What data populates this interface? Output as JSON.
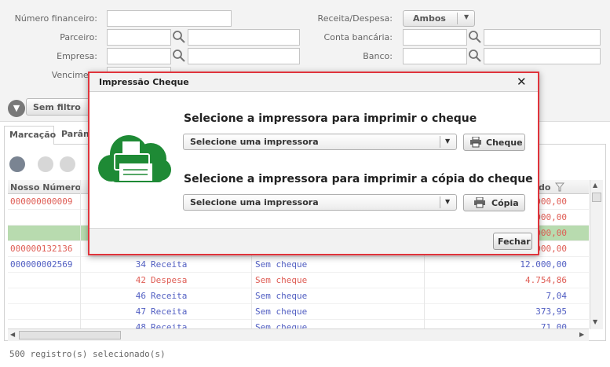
{
  "filters": {
    "numero_financeiro_label": "Número financeiro:",
    "parceiro_label": "Parceiro:",
    "empresa_label": "Empresa:",
    "vencimento_label": "Venciment",
    "receita_despesa_label": "Receita/Despesa:",
    "receita_despesa_value": "Ambos",
    "conta_bancaria_label": "Conta bancária:",
    "banco_label": "Banco:",
    "sem_filtro_label": "Sem filtro"
  },
  "tabs": [
    {
      "label": "Marcação"
    },
    {
      "label": "Parâm"
    }
  ],
  "grid": {
    "col_nosso_numero": "Nosso Número",
    "col_valor_partial": "do",
    "rows": [
      {
        "nosso_numero": "000000000009",
        "num": "",
        "tipo": "",
        "cheque": "",
        "valor": "000,00",
        "nn_color": "#d8392f",
        "tipo_color": "#2b3bb5",
        "valor_color": "#d8392f",
        "highlight": false
      },
      {
        "nosso_numero": "",
        "num": "",
        "tipo": "",
        "cheque": "",
        "valor": "000,00",
        "nn_color": "#d8392f",
        "tipo_color": "#2b3bb5",
        "valor_color": "#d8392f",
        "highlight": false
      },
      {
        "nosso_numero": "",
        "num": "",
        "tipo": "",
        "cheque": "",
        "valor": "000,00",
        "nn_color": "#d8392f",
        "tipo_color": "#2b3bb5",
        "valor_color": "#d8392f",
        "highlight": true
      },
      {
        "nosso_numero": "000000132136",
        "num": "",
        "tipo": "",
        "cheque": "",
        "valor": "000,00",
        "nn_color": "#d8392f",
        "tipo_color": "#2b3bb5",
        "valor_color": "#d8392f",
        "highlight": false
      },
      {
        "nosso_numero": "000000002569",
        "num": "34",
        "tipo": "Receita",
        "cheque": "Sem cheque",
        "valor": "12.000,00",
        "nn_color": "#2b3bb5",
        "tipo_color": "#2b3bb5",
        "valor_color": "#2b3bb5",
        "highlight": false
      },
      {
        "nosso_numero": "",
        "num": "42",
        "tipo": "Despesa",
        "cheque": "Sem cheque",
        "valor": "4.754,86",
        "nn_color": "#d8392f",
        "tipo_color": "#d8392f",
        "valor_color": "#d8392f",
        "highlight": false
      },
      {
        "nosso_numero": "",
        "num": "46",
        "tipo": "Receita",
        "cheque": "Sem cheque",
        "valor": "7,04",
        "nn_color": "#2b3bb5",
        "tipo_color": "#2b3bb5",
        "valor_color": "#2b3bb5",
        "highlight": false
      },
      {
        "nosso_numero": "",
        "num": "47",
        "tipo": "Receita",
        "cheque": "Sem cheque",
        "valor": "373,95",
        "nn_color": "#2b3bb5",
        "tipo_color": "#2b3bb5",
        "valor_color": "#2b3bb5",
        "highlight": false
      },
      {
        "nosso_numero": "",
        "num": "48",
        "tipo": "Receita",
        "cheque": "Sem cheque",
        "valor": "71,00",
        "nn_color": "#2b3bb5",
        "tipo_color": "#2b3bb5",
        "valor_color": "#2b3bb5",
        "highlight": false
      }
    ]
  },
  "status_text": "500 registro(s) selecionado(s)",
  "modal": {
    "title": "Impressão Cheque",
    "close_symbol": "✕",
    "heading_cheque": "Selecione a impressora para imprimir o cheque",
    "select_cheque_value": "Selecione uma impressora",
    "btn_cheque_label": "Cheque",
    "heading_copia": "Selecione a impressora para imprimir a cópia do cheque",
    "select_copia_value": "Selecione uma impressora",
    "btn_copia_label": "Cópia",
    "fechar_label": "Fechar"
  },
  "colors": {
    "accent_red": "#e0343c",
    "printer_green": "#1e8a35",
    "highlight_row": "#a9d39e"
  },
  "icons": {
    "search": "search-icon",
    "filter": "filter-icon",
    "printer": "printer-icon",
    "cloud_printer": "cloud-printer-icon"
  }
}
